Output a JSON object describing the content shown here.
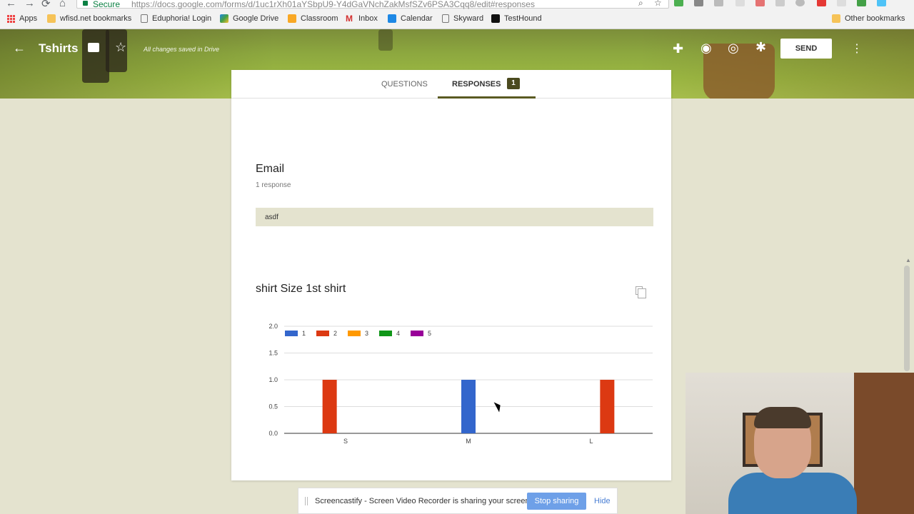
{
  "browser": {
    "secure_label": "Secure",
    "url": "https://docs.google.com/forms/d/1uc1rXh01aYSbpU9-Y4dGaVNchZakMsfSZv6PSA3Cqq8/edit#responses",
    "bookmarks": [
      {
        "label": "Apps",
        "icon": "apps-grid-icon"
      },
      {
        "label": "wfisd.net bookmarks",
        "icon": "folder-icon"
      },
      {
        "label": "Eduphoria! Login",
        "icon": "page-icon"
      },
      {
        "label": "Google Drive",
        "icon": "drive-icon"
      },
      {
        "label": "Classroom",
        "icon": "classroom-icon"
      },
      {
        "label": "Inbox",
        "icon": "gmail-icon"
      },
      {
        "label": "Calendar",
        "icon": "calendar-icon"
      },
      {
        "label": "Skyward",
        "icon": "page-icon"
      },
      {
        "label": "TestHound",
        "icon": "testhound-icon"
      }
    ],
    "other_bookmarks": "Other bookmarks"
  },
  "header": {
    "title": "Tshirts",
    "saved_status": "All changes saved in Drive",
    "send_label": "SEND"
  },
  "tabs": {
    "questions": "QUESTIONS",
    "responses": "RESPONSES",
    "responses_count": "1"
  },
  "questions": [
    {
      "title": "Email",
      "subtitle": "1 response",
      "answer": "asdf"
    },
    {
      "title": "shirt Size 1st shirt"
    }
  ],
  "chart_data": {
    "type": "bar",
    "categories": [
      "S",
      "M",
      "L"
    ],
    "series": [
      {
        "name": "1",
        "values": [
          0,
          1,
          0
        ],
        "color": "#3366cc"
      },
      {
        "name": "2",
        "values": [
          1,
          0,
          1
        ],
        "color": "#dc3912"
      },
      {
        "name": "3",
        "values": [
          0,
          0,
          0
        ],
        "color": "#ff9900"
      },
      {
        "name": "4",
        "values": [
          0,
          0,
          0
        ],
        "color": "#109618"
      },
      {
        "name": "5",
        "values": [
          0,
          0,
          0
        ],
        "color": "#990099"
      }
    ],
    "ylim": [
      0,
      2
    ],
    "yticks": [
      "0.0",
      "0.5",
      "1.0",
      "1.5",
      "2.0"
    ],
    "legend_position": "top-left",
    "grid": true
  },
  "screencastify": {
    "message": "Screencastify - Screen Video Recorder is sharing your screen.",
    "stop_label": "Stop sharing",
    "hide_label": "Hide"
  }
}
